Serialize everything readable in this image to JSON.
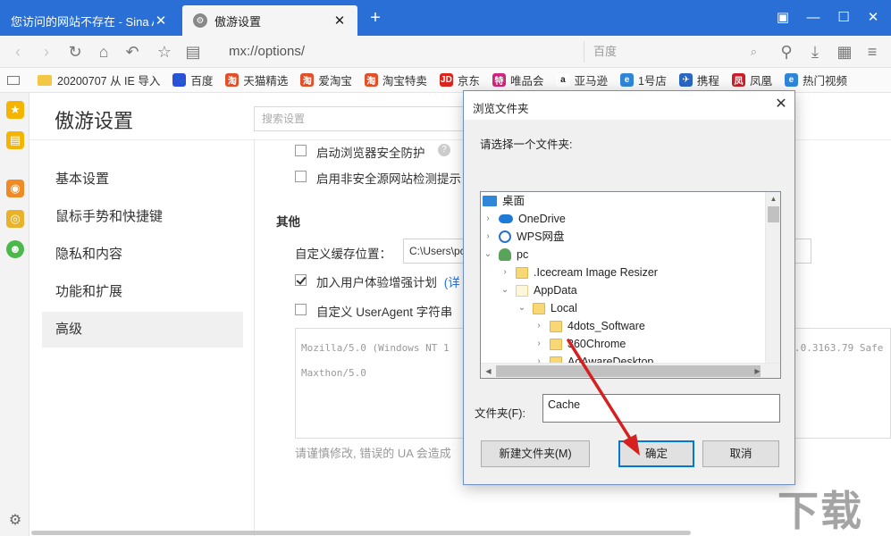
{
  "tabs": [
    {
      "title": "您访问的网站不存在 - Sina A"
    },
    {
      "title": "傲游设置"
    }
  ],
  "nav": {
    "url": "mx://options/",
    "search_placeholder": "百度"
  },
  "bookmarks": [
    {
      "label": "20200707 从 IE 导入",
      "color": "#f3c643",
      "icon": "folder-icon"
    },
    {
      "label": "百度",
      "color": "#2b4fd8",
      "icon": "baidu-icon"
    },
    {
      "label": "天猫精选",
      "color": "#e2502a",
      "icon": "tmall-icon"
    },
    {
      "label": "爱淘宝",
      "color": "#e2502a",
      "icon": "taobao-icon"
    },
    {
      "label": "淘宝特卖",
      "color": "#e2502a",
      "icon": "taobao-icon"
    },
    {
      "label": "京东",
      "color": "#d9251c",
      "icon": "jd-icon"
    },
    {
      "label": "唯品会",
      "color": "#d4237a",
      "icon": "vip-icon"
    },
    {
      "label": "亚马逊",
      "color": "#222222",
      "icon": "amazon-icon"
    },
    {
      "label": "1号店",
      "color": "#2f86d9",
      "icon": "yhd-icon"
    },
    {
      "label": "携程",
      "color": "#2a66c4",
      "icon": "ctrip-icon"
    },
    {
      "label": "凤凰",
      "color": "#c8202a",
      "icon": "ifeng-icon"
    },
    {
      "label": "热门视频",
      "color": "#2f86d9",
      "icon": "video-icon"
    }
  ],
  "settings": {
    "title": "傲游设置",
    "search_placeholder": "搜索设置",
    "nav_items": [
      "基本设置",
      "鼠标手势和快捷键",
      "隐私和内容",
      "功能和扩展",
      "高级"
    ],
    "options": {
      "security_protect": "启动浏览器安全防护",
      "unsafe_detect": "启用非安全源网站检测提示",
      "section_other": "其他",
      "cache_location_label": "自定义缓存位置：",
      "cache_path": "C:\\Users\\pc",
      "ux_program": "加入用户体验增强计划",
      "ux_link": "(详",
      "custom_ua": "自定义 UserAgent 字符串",
      "ua_line1_left": "Mozilla/5.0 (Windows NT 1",
      "ua_line1_right": ".0.3163.79 Safe",
      "ua_line2": "Maxthon/5.0",
      "warning": "请谨慎修改, 错误的 UA 会造成"
    }
  },
  "dialog": {
    "title": "浏览文件夹",
    "prompt": "请选择一个文件夹:",
    "tree": [
      {
        "label": "桌面",
        "icon": "desktop-icon",
        "arrow": ""
      },
      {
        "label": "OneDrive",
        "icon": "onedrive-icon",
        "arrow": "›"
      },
      {
        "label": "WPS网盘",
        "icon": "wps-icon",
        "arrow": "›"
      },
      {
        "label": "pc",
        "icon": "user-icon",
        "arrow": "⌄"
      },
      {
        "label": ".Icecream Image Resizer",
        "icon": "folder-icon",
        "arrow": "›"
      },
      {
        "label": "AppData",
        "icon": "folder-icon",
        "arrow": "⌄"
      },
      {
        "label": "Local",
        "icon": "folder-icon",
        "arrow": "⌄"
      },
      {
        "label": "4dots_Software",
        "icon": "folder-icon",
        "arrow": "›"
      },
      {
        "label": "360Chrome",
        "icon": "folder-icon",
        "arrow": "›"
      },
      {
        "label": "AdAwareDesktop",
        "icon": "folder-icon",
        "arrow": "›"
      }
    ],
    "folder_label": "文件夹(F):",
    "folder_value": "Cache",
    "new_folder_button": "新建文件夹(M)",
    "ok_button": "确定",
    "cancel_button": "取消"
  },
  "colors": {
    "tabbar": "#2a6fd6",
    "annotation_arrow": "#d61f1f"
  }
}
